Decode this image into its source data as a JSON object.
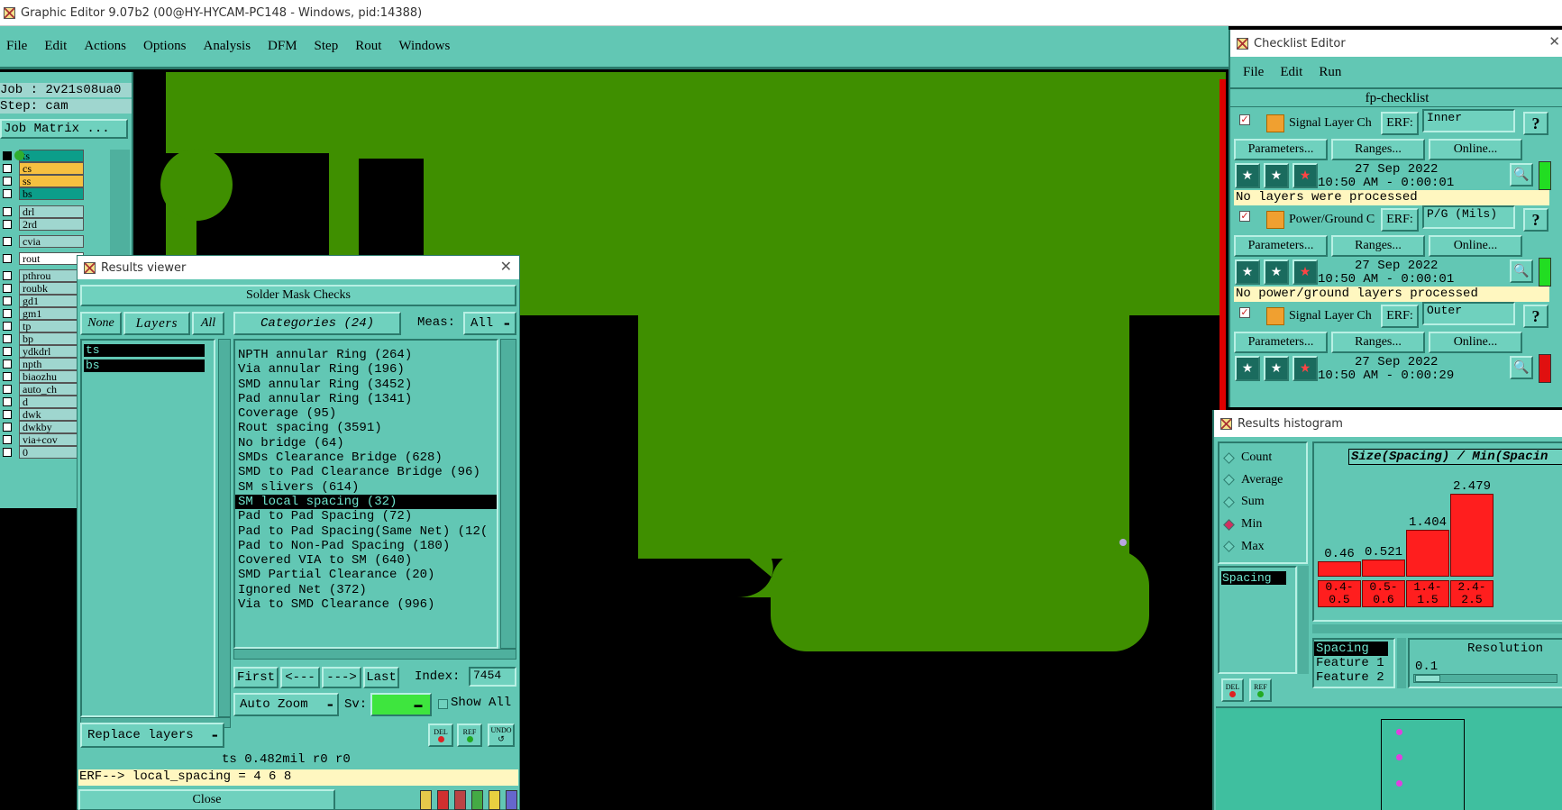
{
  "app": {
    "title": "Graphic Editor 9.07b2 (00@HY-HYCAM-PC148 - Windows, pid:14388)"
  },
  "menu": [
    "File",
    "Edit",
    "Actions",
    "Options",
    "Analysis",
    "DFM",
    "Step",
    "Rout",
    "Windows"
  ],
  "job": {
    "job_label": "Job : 2v21s08ua0",
    "step_label": "Step: cam",
    "matrix_button": "Job Matrix ..."
  },
  "layers": [
    "ts",
    "cs",
    "ss",
    "bs",
    "drl",
    "2rd",
    "cvia",
    "rout",
    "pthrou",
    "roubk",
    "gd1",
    "gm1",
    "tp",
    "bp",
    "ydkdrl",
    "npth",
    "biaozhu",
    "auto_ch",
    "d",
    "dwk",
    "dwkby",
    "via+cov",
    "0"
  ],
  "results_viewer": {
    "title": "Results viewer",
    "header": "Solder Mask Checks",
    "none_btn": "None",
    "layers_btn": "Layers",
    "all_btn": "All",
    "categories_btn": "Categories (24)",
    "meas_label": "Meas:",
    "meas_value": "All",
    "selected_layers": [
      "ts",
      "bs"
    ],
    "categories": [
      "NPTH annular Ring (264)",
      "Via annular Ring (196)",
      "SMD annular Ring (3452)",
      "Pad annular Ring (1341)",
      "Coverage (95)",
      "Rout spacing (3591)",
      "No bridge (64)",
      "SMDs Clearance Bridge (628)",
      "SMD to Pad Clearance Bridge (96)",
      "SM slivers (614)",
      "SM local spacing (32)",
      "Pad to Pad Spacing (72)",
      "Pad to Pad Spacing(Same Net) (12(",
      "Pad to Non-Pad Spacing (180)",
      "Covered VIA to SM (640)",
      "SMD Partial Clearance (20)",
      "Ignored Net (372)",
      "Via to SMD Clearance (996)"
    ],
    "selected_index": 10,
    "first_btn": "First",
    "prev_btn": "<---",
    "next_btn": "--->",
    "last_btn": "Last",
    "index_label": "Index:",
    "index_value": "7454",
    "zoom_value": "Auto Zoom",
    "sv_label": "Sv:",
    "show_all_label": "Show All",
    "replace_btn": "Replace layers",
    "del_label": "DEL",
    "ref_label": "REF",
    "undo_label": "UNDO",
    "status": "ts 0.482mil  r0  r0",
    "erf_line": "ERF--> local_spacing = 4 6 8",
    "close_btn": "Close"
  },
  "checklist": {
    "title": "Checklist Editor",
    "menu": [
      "File",
      "Edit",
      "Run"
    ],
    "name": "fp-checklist",
    "params_btn": "Parameters...",
    "ranges_btn": "Ranges...",
    "online_btn": "Online...",
    "erf_label": "ERF:",
    "items": [
      {
        "name": "Signal Layer Ch",
        "erf": "Inner",
        "date": "27 Sep 2022",
        "time": "10:50 AM - 0:00:01",
        "message": "No layers were processed",
        "status": "green"
      },
      {
        "name": "Power/Ground C",
        "erf": "P/G (Mils)",
        "date": "27 Sep 2022",
        "time": "10:50 AM - 0:00:01",
        "message": "No power/ground layers processed",
        "status": "green"
      },
      {
        "name": "Signal Layer Ch",
        "erf": "Outer",
        "date": "27 Sep 2022",
        "time": "10:50 AM - 0:00:29",
        "message": "",
        "status": "red"
      }
    ]
  },
  "histogram": {
    "title": "Results histogram",
    "modes": [
      "Count",
      "Average",
      "Sum",
      "Min",
      "Max"
    ],
    "selected_mode": "Min",
    "list_item": "Spacing",
    "chart_title": "Size(Spacing) / Min(Spacin",
    "table": [
      "Spacing",
      "Feature 1",
      "Feature 2"
    ],
    "resolution_label": "Resolution",
    "resolution_value": "0.1"
  },
  "chart_data": {
    "type": "bar",
    "title": "Size(Spacing) / Min(Spacin",
    "categories": [
      "0.4-0.5",
      "0.5-0.6",
      "1.4-1.5",
      "2.4-2.5"
    ],
    "values": [
      0.46,
      0.521,
      1.404,
      2.479
    ],
    "ylim": [
      0,
      2.479
    ]
  },
  "colors": {
    "canvas_green": "#3f8f00",
    "panel_teal": "#62c7b4",
    "bar_red": "#ff1e1e"
  }
}
